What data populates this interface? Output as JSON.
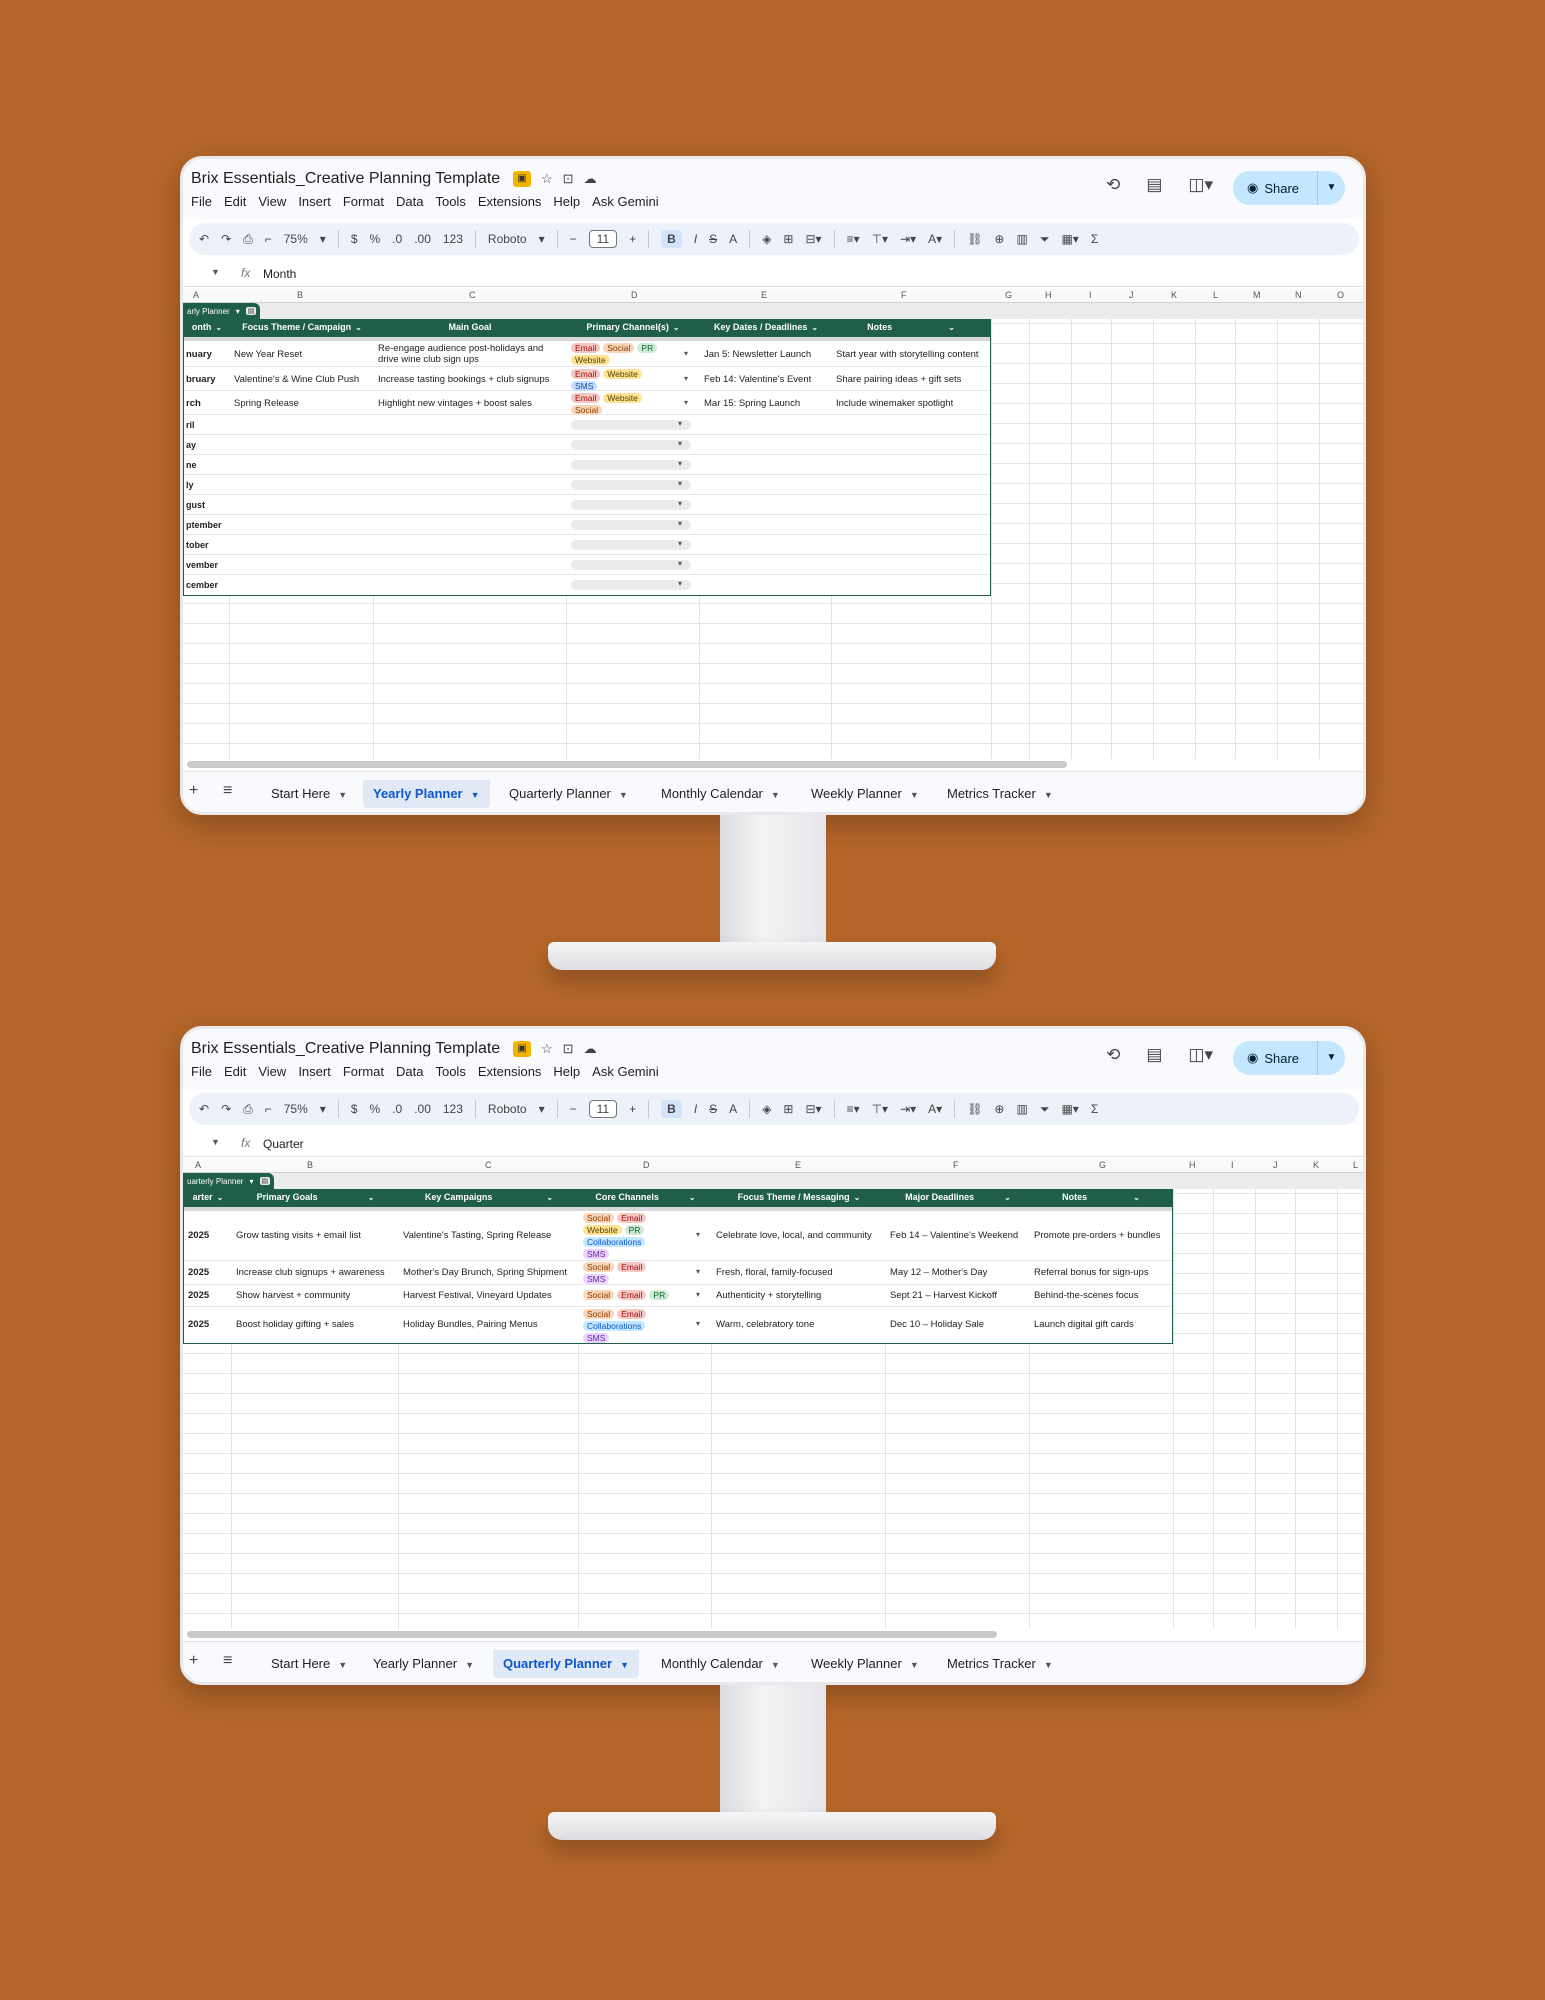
{
  "app": {
    "title": "Brix Essentials_Creative Planning Template",
    "menu": [
      "File",
      "Edit",
      "View",
      "Insert",
      "Format",
      "Data",
      "Tools",
      "Extensions",
      "Help",
      "Ask Gemini"
    ],
    "share_label": "Share",
    "toolbar": {
      "zoom": "75%",
      "currency": "$",
      "percent": "%",
      "dec_minus": ".0",
      "dec_plus": ".00",
      "number_format": "123",
      "font": "Roboto",
      "font_size": "11",
      "bold": "B",
      "italic": "I",
      "strike": "S",
      "text_color": "A"
    },
    "sheet_tabs": [
      "Start Here",
      "Yearly Planner",
      "Quarterly Planner",
      "Monthly Calendar",
      "Weekly Planner",
      "Metrics Tracker"
    ]
  },
  "yearly": {
    "formula_value": "Month",
    "table_name": "arly Planner",
    "active_tab": "Yearly Planner",
    "col_letters": [
      "A",
      "B",
      "C",
      "D",
      "E",
      "F",
      "G",
      "H",
      "I",
      "J",
      "K",
      "L",
      "M",
      "N",
      "O"
    ],
    "headers": [
      "onth",
      "Focus Theme / Campaign",
      "Main Goal",
      "Primary Channel(s)",
      "Key Dates / Deadlines",
      "Notes"
    ],
    "rows": [
      {
        "month": "nuary",
        "theme": "New Year Reset",
        "goal_1": "Re-engage audience post-holidays and",
        "goal_2": "drive wine club sign ups",
        "channels": [
          "Email",
          "Social",
          "PR",
          "Website"
        ],
        "dates": "Jan 5: Newsletter Launch",
        "notes": "Start year with storytelling content"
      },
      {
        "month": "bruary",
        "theme": "Valentine's & Wine Club Push",
        "goal_1": "Increase tasting bookings + club signups",
        "goal_2": "",
        "channels": [
          "Email",
          "Website",
          "SMS"
        ],
        "dates": "Feb 14: Valentine's Event",
        "notes": "Share pairing ideas + gift sets"
      },
      {
        "month": "rch",
        "theme": "Spring Release",
        "goal_1": "Highlight new vintages + boost sales",
        "goal_2": "",
        "channels": [
          "Email",
          "Website",
          "Social"
        ],
        "dates": "Mar 15: Spring Launch",
        "notes": "Include winemaker spotlight"
      }
    ],
    "empty_months": [
      "ril",
      "ay",
      "ne",
      "ly",
      "gust",
      "ptember",
      "tober",
      "vember",
      "cember"
    ]
  },
  "quarterly": {
    "formula_value": "Quarter",
    "table_name": "uarterly Planner",
    "active_tab": "Quarterly Planner",
    "col_letters": [
      "A",
      "B",
      "C",
      "D",
      "E",
      "F",
      "G",
      "H",
      "I",
      "J",
      "K",
      "L"
    ],
    "headers": [
      "arter",
      "Primary Goals",
      "Key Campaigns",
      "Core Channels",
      "Focus Theme / Messaging",
      "Major Deadlines",
      "Notes"
    ],
    "rows": [
      {
        "quarter": "2025",
        "goals": "Grow tasting visits + email list",
        "campaigns": "Valentine's Tasting, Spring Release",
        "channels": [
          "Social",
          "Email",
          "Website",
          "PR",
          "Collaborations",
          "SMS"
        ],
        "theme": "Celebrate love, local, and community",
        "deadline": "Feb 14 – Valentine's Weekend",
        "notes": "Promote pre-orders + bundles"
      },
      {
        "quarter": "2025",
        "goals": "Increase club signups + awareness",
        "campaigns": "Mother's Day Brunch, Spring Shipment",
        "channels": [
          "Social",
          "Email",
          "SMS"
        ],
        "theme": "Fresh, floral, family-focused",
        "deadline": "May 12 – Mother's Day",
        "notes": "Referral bonus for sign-ups"
      },
      {
        "quarter": "2025",
        "goals": "Show harvest + community",
        "campaigns": "Harvest Festival, Vineyard Updates",
        "channels": [
          "Social",
          "Email",
          "PR"
        ],
        "theme": "Authenticity + storytelling",
        "deadline": "Sept 21 – Harvest Kickoff",
        "notes": "Behind-the-scenes focus"
      },
      {
        "quarter": "2025",
        "goals": "Boost holiday gifting + sales",
        "campaigns": "Holiday Bundles, Pairing Menus",
        "channels": [
          "Social",
          "Email",
          "Collaborations",
          "SMS"
        ],
        "theme": "Warm, celebratory tone",
        "deadline": "Dec 10 – Holiday Sale",
        "notes": "Launch digital gift cards"
      }
    ]
  }
}
